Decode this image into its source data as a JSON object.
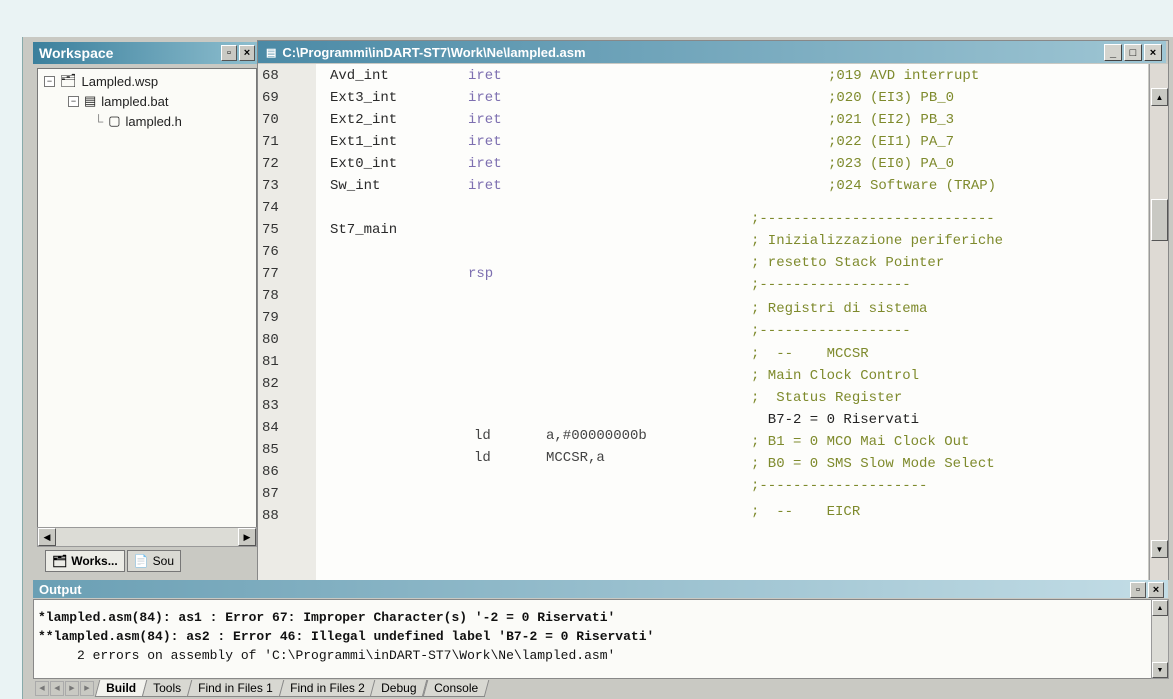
{
  "workspace": {
    "title": "Workspace",
    "tree": [
      {
        "label": "Lampled.wsp",
        "toggle": "−"
      },
      {
        "label": "lampled.bat",
        "toggle": "−"
      },
      {
        "label": "lampled.h",
        "toggle": ""
      }
    ],
    "tabs": [
      {
        "label": "Works...",
        "icon": "workspace-icon"
      },
      {
        "label": "Sou",
        "icon": "source-icon"
      }
    ]
  },
  "editor": {
    "title": "C:\\Programmi\\inDART-ST7\\Work\\Ne\\lampled.asm",
    "line_numbers": [
      "68",
      "69",
      "70",
      "71",
      "72",
      "73",
      "74",
      "75",
      "76",
      "77",
      "78",
      "79",
      "80",
      "81",
      "82",
      "83",
      "84",
      "85",
      "86",
      "87",
      "88"
    ],
    "lines": [
      {
        "label": "Avd_int",
        "instr": "iret",
        "comment": ";019 AVD interrupt"
      },
      {
        "label": "Ext3_int",
        "instr": "iret",
        "comment": ";020 (EI3) PB_0"
      },
      {
        "label": "Ext2_int",
        "instr": "iret",
        "comment": ";021 (EI2) PB_3"
      },
      {
        "label": "Ext1_int",
        "instr": "iret",
        "comment": ";022 (EI1) PA_7"
      },
      {
        "label": "Ext0_int",
        "instr": "iret",
        "comment": ";023 (EI0) PA_0"
      },
      {
        "label": "Sw_int",
        "instr": "iret",
        "comment": ";024 Software (TRAP)"
      },
      {
        "label": "",
        "instr": "",
        "comment": ""
      },
      {
        "label": "St7_main",
        "instr": "",
        "comment": ";----------------------------"
      },
      {
        "label": "",
        "instr": "",
        "comment": "; Inizializzazione periferiche"
      },
      {
        "label": "",
        "instr": "rsp",
        "comment": "; resetto Stack Pointer"
      },
      {
        "label": "",
        "instr": "",
        "comment": ";------------------"
      },
      {
        "label": "",
        "instr": "",
        "comment": "; Registri di sistema"
      },
      {
        "label": "",
        "instr": "",
        "comment": ";------------------"
      },
      {
        "label": "",
        "instr": "",
        "comment": ";  --    MCCSR"
      },
      {
        "label": "",
        "instr": "",
        "comment": "; Main Clock Control"
      },
      {
        "label": "",
        "instr": "",
        "comment": ";  Status Register"
      },
      {
        "label": "",
        "instr": "ld",
        "operand": "a,#00000000b",
        "comment": "  B7-2 = 0 Riservati"
      },
      {
        "label": "",
        "instr": "ld",
        "operand": "MCCSR,a",
        "comment": "; B1 = 0 MCO Mai Clock Out"
      },
      {
        "label": "",
        "instr": "",
        "comment": "; B0 = 0 SMS Slow Mode Select"
      },
      {
        "label": "",
        "instr": "",
        "comment": ";--------------------"
      },
      {
        "label": "",
        "instr": "",
        "comment": ";  --    EICR"
      }
    ]
  },
  "output": {
    "title": "Output",
    "lines": [
      "*lampled.asm(84): as1 : Error 67: Improper Character(s) '-2 = 0 Riservati'",
      "**lampled.asm(84): as2 : Error 46: Illegal undefined label 'B7-2 = 0 Riservati'",
      "     2 errors on assembly of 'C:\\Programmi\\inDART-ST7\\Work\\Ne\\lampled.asm'"
    ],
    "tabs": [
      "Build",
      "Tools",
      "Find in Files 1",
      "Find in Files 2",
      "Debug",
      "Console"
    ]
  }
}
